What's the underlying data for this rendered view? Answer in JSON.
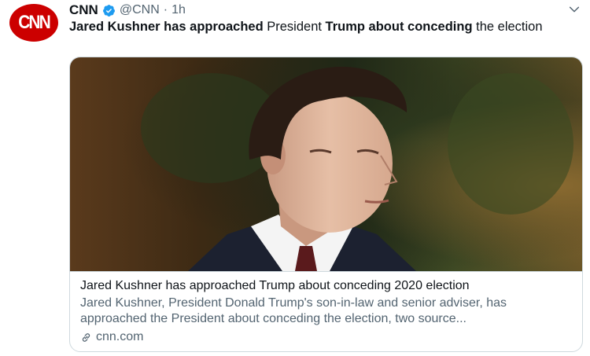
{
  "tweet": {
    "avatar": {
      "text": "CNN",
      "icon": "cnn-logo",
      "color": "#cc0000"
    },
    "author_name": "CNN",
    "verified": true,
    "handle": "@CNN",
    "separator": "·",
    "time": "1h",
    "text_parts": [
      {
        "text": "Jared Kushner has approached",
        "bold": true
      },
      {
        "text": " President ",
        "bold": false
      },
      {
        "text": "Trump about conceding",
        "bold": true
      },
      {
        "text": " the election",
        "bold": false
      }
    ],
    "menu_icon": "chevron-down-icon"
  },
  "card": {
    "image_alt": "Photo of Jared Kushner",
    "title": "Jared Kushner has approached Trump about conceding 2020 election",
    "description": "Jared Kushner, President Donald Trump's son-in-law and senior adviser, has approached the President about conceding the election, two source...",
    "domain": "cnn.com",
    "link_icon": "link-icon"
  },
  "colors": {
    "accent": "#1d9bf0",
    "secondary_text": "#536471",
    "border": "#cfd9de"
  }
}
